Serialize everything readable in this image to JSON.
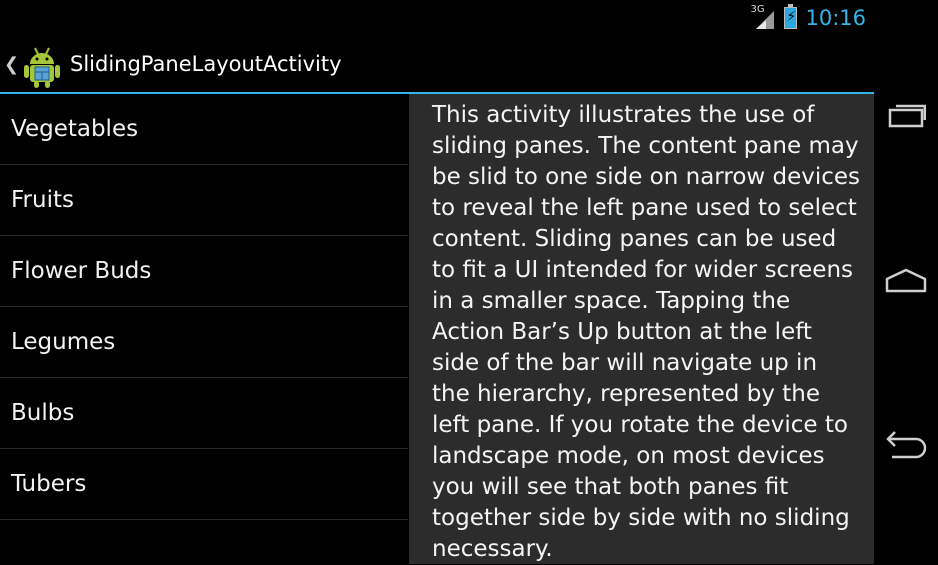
{
  "status_bar": {
    "network_type": "3G",
    "time": "10:16"
  },
  "action_bar": {
    "title": "SlidingPaneLayoutActivity",
    "up_icon": "chevron-left-icon",
    "app_icon": "android-robot-icon"
  },
  "left_pane": {
    "items": [
      {
        "label": "Vegetables"
      },
      {
        "label": "Fruits"
      },
      {
        "label": "Flower Buds"
      },
      {
        "label": "Legumes"
      },
      {
        "label": "Bulbs"
      },
      {
        "label": "Tubers"
      }
    ]
  },
  "content_pane": {
    "text": "This activity illustrates the use of sliding panes. The content pane may be slid to one side on narrow devices to reveal the left pane used to select content. Sliding panes can be used to fit a UI intended for wider screens in a smaller space. Tapping the Action Bar’s Up button at the left side of the bar will navigate up in the hierarchy, represented by the left pane. If you rotate the device to landscape mode, on most devices you will see that both panes fit together side by side with no sliding necessary."
  },
  "nav_bar": {
    "buttons": [
      "recent-apps-icon",
      "home-icon",
      "back-icon"
    ]
  },
  "colors": {
    "accent": "#33b5e5",
    "content_bg": "#2c2c2c",
    "background": "#000000"
  }
}
